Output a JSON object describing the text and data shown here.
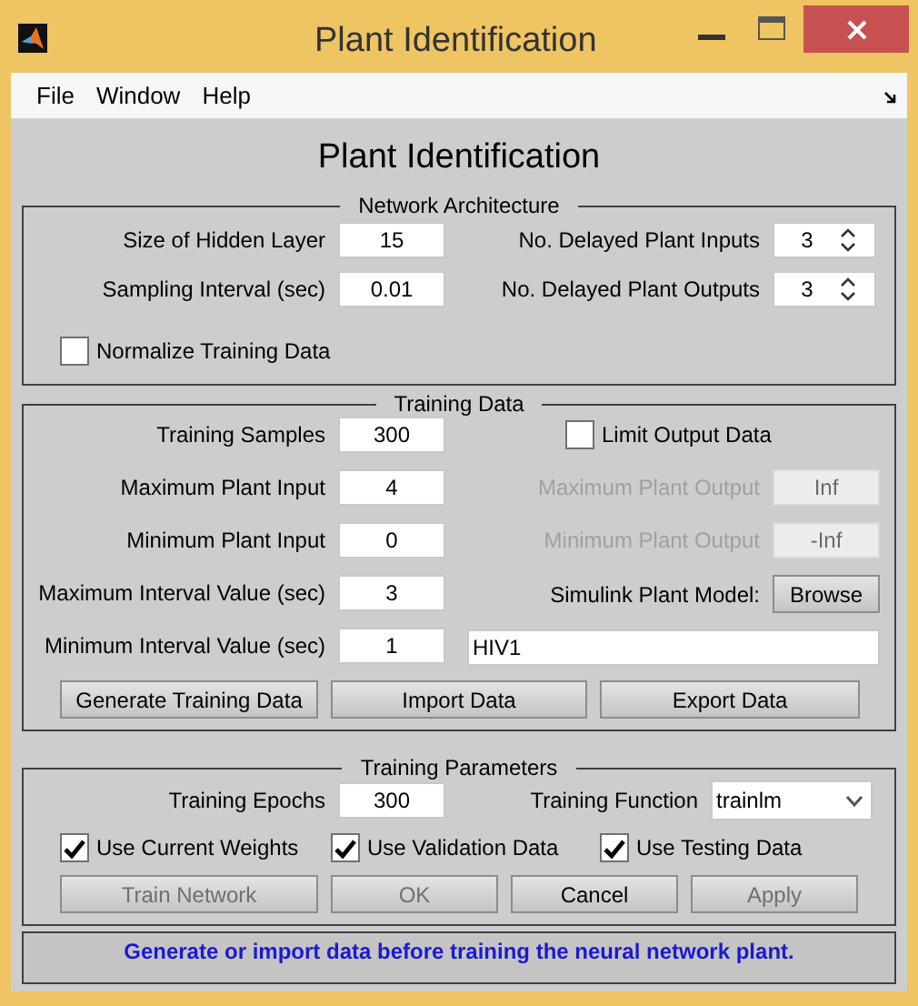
{
  "window": {
    "title": "Plant Identification"
  },
  "menu": [
    {
      "label": "File"
    },
    {
      "label": "Window"
    },
    {
      "label": "Help"
    }
  ],
  "heading": "Plant Identification",
  "architecture": {
    "title": "Network Architecture",
    "fields": [
      {
        "label": "Size of Hidden Layer",
        "value": "15"
      },
      {
        "label": "Sampling Interval (sec)",
        "value": "0.01"
      }
    ],
    "spinners": [
      {
        "label": "No. Delayed Plant Inputs",
        "value": "3"
      },
      {
        "label": "No. Delayed Plant Outputs",
        "value": "3"
      }
    ],
    "normalize": {
      "label": "Normalize Training Data",
      "checked": false
    }
  },
  "training_data": {
    "title": "Training Data",
    "fields": [
      {
        "label": "Training Samples",
        "value": "300"
      },
      {
        "label": "Maximum Plant Input",
        "value": "4"
      },
      {
        "label": "Minimum Plant Input",
        "value": "0"
      },
      {
        "label": "Maximum Interval Value (sec)",
        "value": "3"
      },
      {
        "label": "Minimum Interval Value (sec)",
        "value": "1"
      }
    ],
    "limit_output": {
      "label": "Limit Output Data",
      "checked": false
    },
    "output_fields": [
      {
        "label": "Maximum Plant Output",
        "value": "Inf",
        "disabled": true
      },
      {
        "label": "Minimum Plant Output",
        "value": "-Inf",
        "disabled": true
      }
    ],
    "simulink": {
      "label": "Simulink Plant Model:",
      "button": "Browse"
    },
    "model_name": "HIV1",
    "buttons": [
      {
        "label": "Generate Training Data"
      },
      {
        "label": "Import Data"
      },
      {
        "label": "Export Data"
      }
    ]
  },
  "training_parameters": {
    "title": "Training Parameters",
    "epochs": {
      "label": "Training Epochs",
      "value": "300"
    },
    "function": {
      "label": "Training Function",
      "value": "trainlm"
    },
    "checks": [
      {
        "label": "Use Current Weights",
        "checked": true
      },
      {
        "label": "Use Validation Data",
        "checked": true
      },
      {
        "label": "Use Testing Data",
        "checked": true
      }
    ],
    "buttons": [
      {
        "label": "Train Network",
        "disabled": true
      },
      {
        "label": "OK",
        "disabled": true
      },
      {
        "label": "Cancel",
        "disabled": false
      },
      {
        "label": "Apply",
        "disabled": true
      }
    ]
  },
  "status": "Generate or import data before training the neural network plant."
}
